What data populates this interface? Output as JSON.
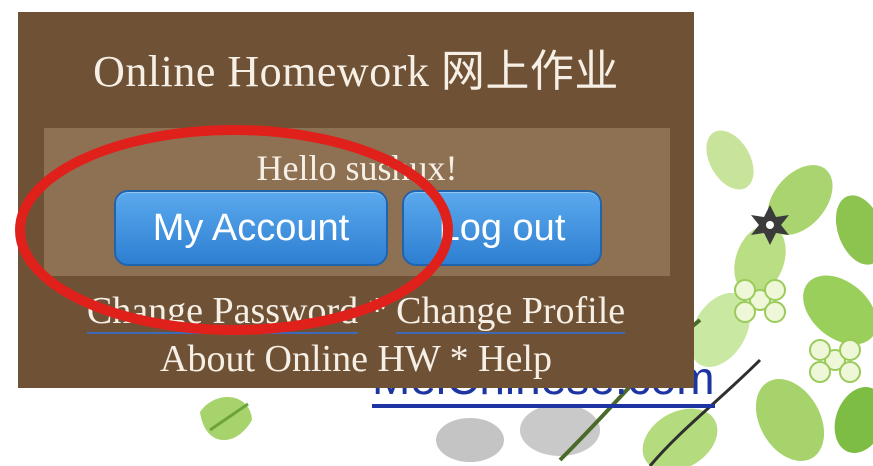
{
  "panel": {
    "title": "Online Homework 网上作业",
    "greeting": "Hello sushux!",
    "buttons": {
      "my_account": "My Account",
      "log_out": "Log out"
    },
    "links_row1": {
      "change_password": "Change Password",
      "separator": "*",
      "change_profile": "Change Profile"
    },
    "links_row2": {
      "about": "About Online HW",
      "separator": "*",
      "help": "Help"
    }
  },
  "site_link": "MeiChinese.com",
  "colors": {
    "panel_bg": "#6f5236",
    "hello_box_bg": "#8e7153",
    "button_blue": "#3d8fdf",
    "highlight_red": "#e0211b",
    "site_link_blue": "#1c35a3"
  },
  "icons": [
    "flower-icon",
    "leaf-icon"
  ]
}
